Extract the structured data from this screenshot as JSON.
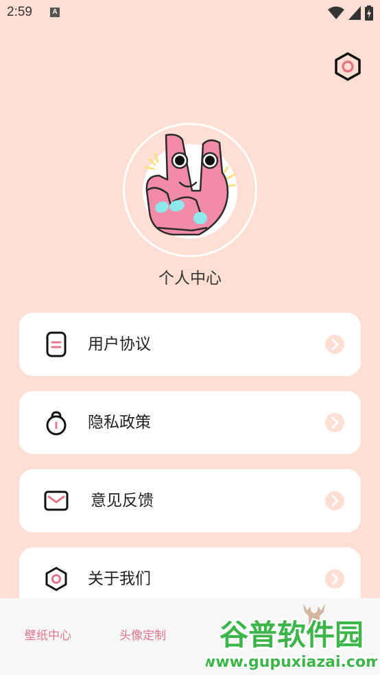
{
  "status_bar": {
    "time": "2:59",
    "notification_icon": "A"
  },
  "profile": {
    "title": "个人中心"
  },
  "menu": [
    {
      "label": "用户协议",
      "icon": "document-icon"
    },
    {
      "label": "隐私政策",
      "icon": "lock-icon"
    },
    {
      "label": "意见反馈",
      "icon": "mail-icon"
    },
    {
      "label": "关于我们",
      "icon": "hexagon-icon"
    }
  ],
  "bottom_nav": {
    "items": [
      "壁纸中心",
      "头像定制"
    ]
  },
  "watermark": {
    "brand": "谷普软件园",
    "url": "www.gupuxiazai.com"
  },
  "colors": {
    "background": "#ffded4",
    "accent": "#e57589",
    "card": "#ffffff"
  }
}
